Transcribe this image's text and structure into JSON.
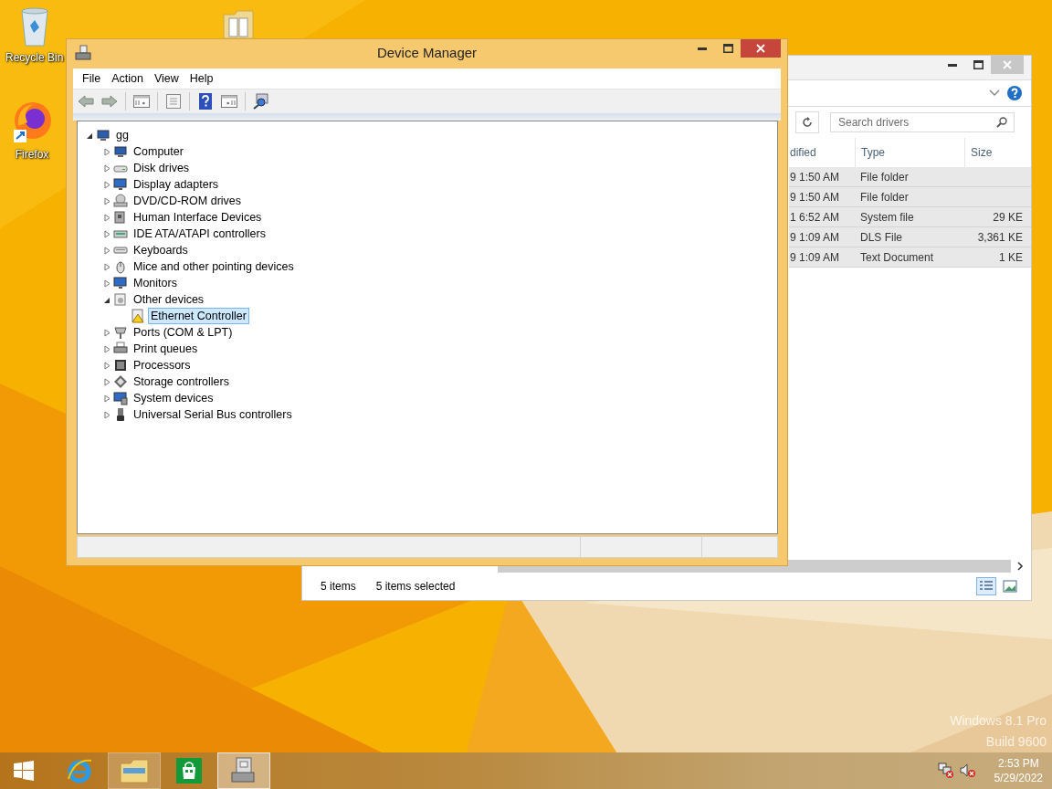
{
  "desktop": {
    "icons": [
      {
        "kind": "recycle_bin",
        "label": "Recycle Bin"
      },
      {
        "kind": "firefox",
        "label": "Firefox"
      },
      {
        "kind": "folder"
      }
    ]
  },
  "explorer": {
    "search": {
      "placeholder": "Search drivers"
    },
    "columns": [
      "dified",
      "Type",
      "Size"
    ],
    "rows": [
      {
        "modified": "9 1:50 AM",
        "type": "File folder",
        "selected": true
      },
      {
        "modified": "9 1:50 AM",
        "type": "File folder",
        "selected": true
      },
      {
        "modified": "1 6:52 AM",
        "type": "System file",
        "size": "29 KE",
        "selected": true
      },
      {
        "modified": "9 1:09 AM",
        "type": "DLS File",
        "size": "3,361 KE",
        "selected": true
      },
      {
        "modified": "9 1:09 AM",
        "type": "Text Document",
        "size": "1 KE",
        "selected": true
      }
    ],
    "status": [
      "5 items",
      "5 items selected"
    ],
    "views": [
      {
        "kind": "details",
        "selected": true
      },
      {
        "kind": "large_icons",
        "selected": false
      }
    ]
  },
  "device_manager": {
    "title": "Device Manager",
    "menu": [
      "File",
      "Action",
      "View",
      "Help"
    ],
    "tree": {
      "label": "gg",
      "kind": "root",
      "expanded": true,
      "selected": false,
      "children": [
        {
          "label": "Computer",
          "kind": "computer",
          "expanded": false,
          "selected": false
        },
        {
          "label": "Disk drives",
          "kind": "disk",
          "expanded": false,
          "selected": false
        },
        {
          "label": "Display adapters",
          "kind": "display",
          "expanded": false,
          "selected": false
        },
        {
          "label": "DVD/CD-ROM drives",
          "kind": "dvd",
          "expanded": false,
          "selected": false
        },
        {
          "label": "Human Interface Devices",
          "kind": "hid",
          "expanded": false,
          "selected": false
        },
        {
          "label": "IDE ATA/ATAPI controllers",
          "kind": "ide",
          "expanded": false,
          "selected": false
        },
        {
          "label": "Keyboards",
          "kind": "keyboard",
          "expanded": false,
          "selected": false
        },
        {
          "label": "Mice and other pointing devices",
          "kind": "mouse",
          "expanded": false,
          "selected": false
        },
        {
          "label": "Monitors",
          "kind": "monitor",
          "expanded": false,
          "selected": false
        },
        {
          "label": "Other devices",
          "kind": "other",
          "expanded": true,
          "selected": false,
          "children": [
            {
              "label": "Ethernet Controller",
              "kind": "warning",
              "selected": true
            }
          ]
        },
        {
          "label": "Ports (COM & LPT)",
          "kind": "port",
          "expanded": false,
          "selected": false
        },
        {
          "label": "Print queues",
          "kind": "printer",
          "expanded": false,
          "selected": false
        },
        {
          "label": "Processors",
          "kind": "processor",
          "expanded": false,
          "selected": false
        },
        {
          "label": "Storage controllers",
          "kind": "storage",
          "expanded": false,
          "selected": false
        },
        {
          "label": "System devices",
          "kind": "system",
          "expanded": false,
          "selected": false
        },
        {
          "label": "Universal Serial Bus controllers",
          "kind": "usb",
          "expanded": false,
          "selected": false
        }
      ]
    }
  },
  "os_edition": [
    "Windows 8.1 Pro",
    "Build 9600"
  ],
  "taskbar": {
    "apps": [
      {
        "kind": "start",
        "open": false,
        "focused": false
      },
      {
        "kind": "ie",
        "open": false,
        "focused": false
      },
      {
        "kind": "explorer",
        "open": true,
        "focused": false
      },
      {
        "kind": "store",
        "open": false,
        "focused": false
      },
      {
        "kind": "device_manager",
        "open": true,
        "focused": true
      }
    ],
    "clock": {
      "time": "2:53 PM",
      "date": "5/29/2022"
    }
  }
}
